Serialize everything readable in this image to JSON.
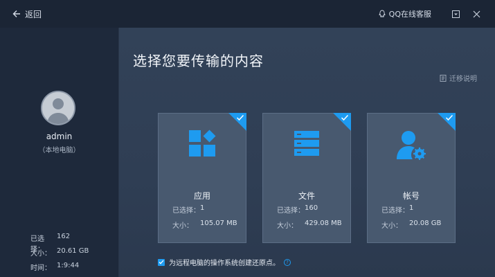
{
  "titlebar": {
    "back_label": "返回",
    "support_label": "QQ在线客服"
  },
  "sidebar": {
    "username": "admin",
    "device_label": "（本地电脑）",
    "stats": [
      {
        "label": "已选择：",
        "value": "162"
      },
      {
        "label": "大小：",
        "value": "20.61 GB"
      },
      {
        "label": "时间：",
        "value": "1:9:44"
      }
    ]
  },
  "main": {
    "title": "选择您要传输的内容",
    "help_label": "迁移说明",
    "cards": [
      {
        "name": "应用",
        "selected_label": "已选择：",
        "selected": "1",
        "size_label": "大小：",
        "size": "105.07 MB",
        "icon": "apps-icon"
      },
      {
        "name": "文件",
        "selected_label": "已选择：",
        "selected": "160",
        "size_label": "大小：",
        "size": "429.08 MB",
        "icon": "files-icon"
      },
      {
        "name": "帐号",
        "selected_label": "已选择：",
        "selected": "1",
        "size_label": "大小：",
        "size": "20.08 GB",
        "icon": "account-icon"
      }
    ],
    "restore_label": "为远程电脑的操作系统创建还原点。",
    "accent": "#1e9bf0"
  }
}
